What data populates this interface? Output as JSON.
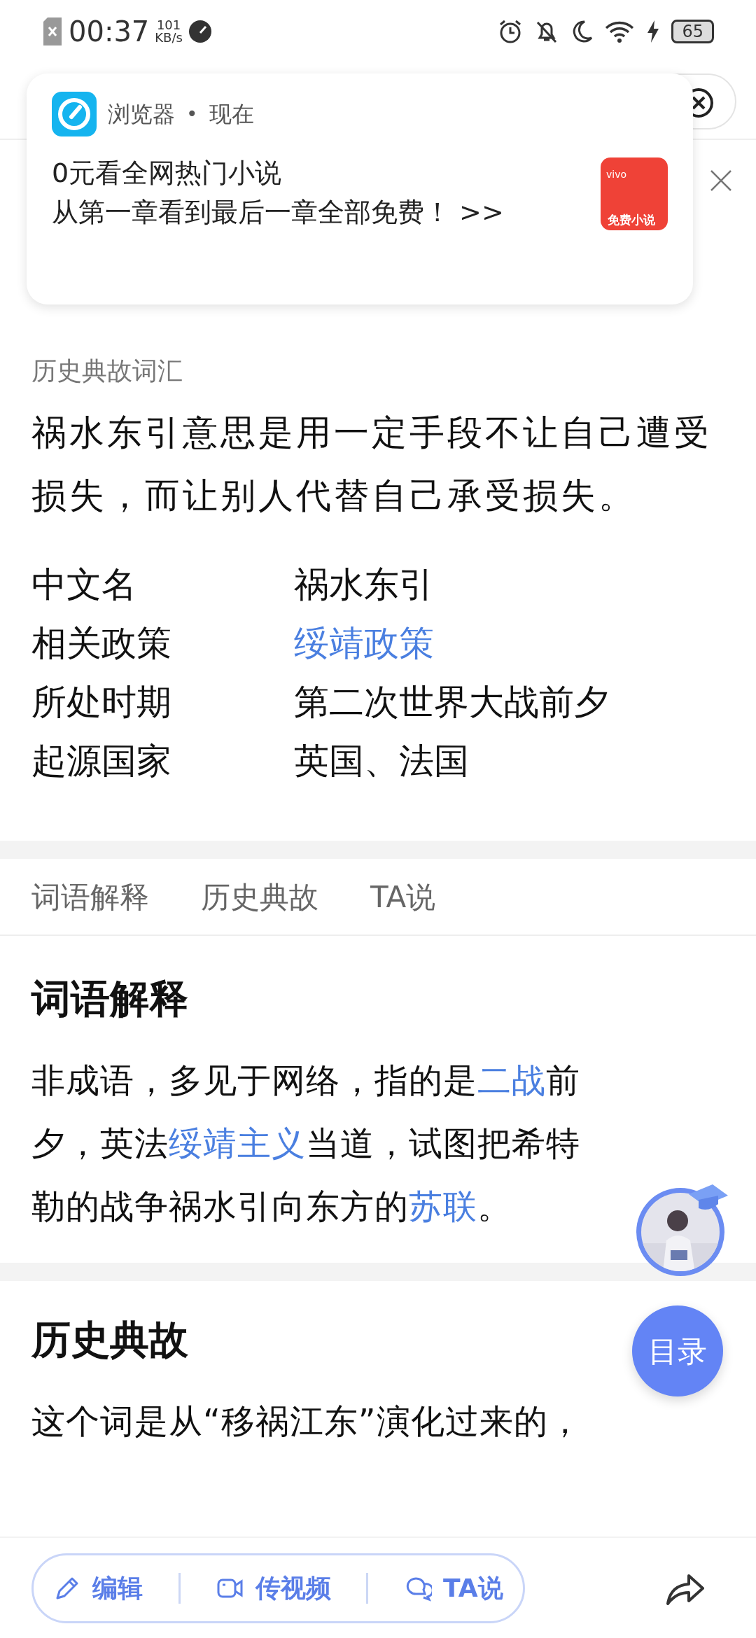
{
  "status_bar": {
    "time": "00:37",
    "speed_value": "101",
    "speed_unit": "KB/s",
    "battery": "65"
  },
  "notification": {
    "app": "浏览器",
    "separator": "•",
    "when": "现在",
    "title": "0元看全网热门小说",
    "body": "从第一章看到最后一章全部免费！ >>",
    "thumb_brand": "vivo",
    "thumb_caption": "免费小说"
  },
  "entry": {
    "subtitle": "历史典故词汇",
    "summary": "祸水东引意思是用一定手段不让自己遭受损失，而让别人代替自己承受损失。",
    "info": [
      {
        "label": "中文名",
        "value": "祸水东引",
        "link": false
      },
      {
        "label": "相关政策",
        "value": "绥靖政策",
        "link": true
      },
      {
        "label": "所处时期",
        "value": "第二次世界大战前夕",
        "link": false
      },
      {
        "label": "起源国家",
        "value": "英国、法国",
        "link": false
      }
    ]
  },
  "tabs": [
    {
      "label": "词语解释",
      "selected": false
    },
    {
      "label": "历史典故",
      "selected": false
    },
    {
      "label": "TA说",
      "selected": false
    }
  ],
  "sections": [
    {
      "heading": "词语解释",
      "paragraph": [
        {
          "text": "非成语，多见于网络，指的是",
          "link": false
        },
        {
          "text": "二战",
          "link": true
        },
        {
          "text": "前夕，英法",
          "link": false
        },
        {
          "text": "绥靖主义",
          "link": true
        },
        {
          "text": "当道，试图把希特勒的战争祸水引向东方的",
          "link": false
        },
        {
          "text": "苏联",
          "link": true
        },
        {
          "text": "。",
          "link": false
        }
      ]
    },
    {
      "heading": "历史典故",
      "paragraph": [
        {
          "text": "这个词是从“移祸江东”演化过来的，",
          "link": false
        }
      ]
    }
  ],
  "toc_button": "目录",
  "bottom_bar": {
    "actions": [
      {
        "kind": "edit",
        "label": "编辑"
      },
      {
        "kind": "video",
        "label": "传视频"
      },
      {
        "kind": "chat",
        "label": "TA说"
      }
    ]
  }
}
